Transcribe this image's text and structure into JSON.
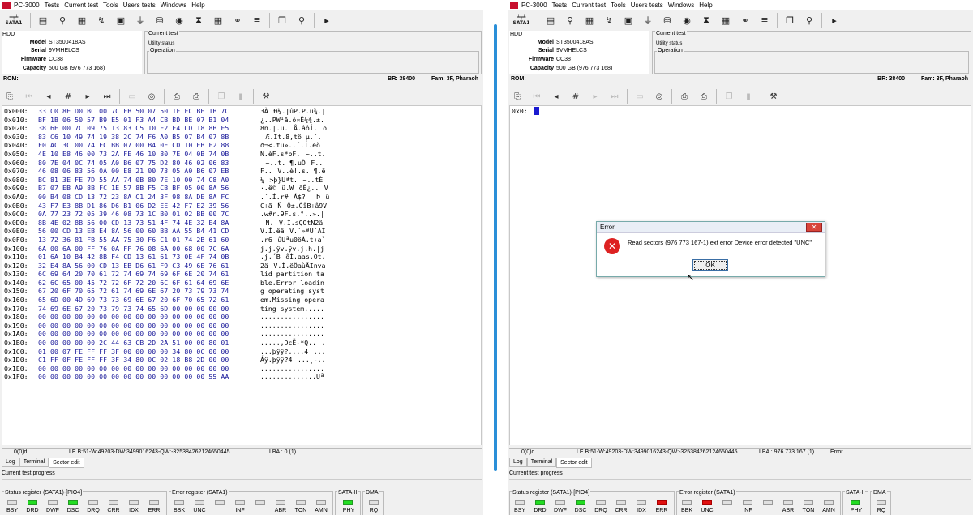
{
  "app": {
    "title": "PC-3000"
  },
  "menu": [
    "Tests",
    "Current test",
    "Tools",
    "Users tests",
    "Windows",
    "Help"
  ],
  "toolbar": {
    "sata_label": "SATA1"
  },
  "hdd": {
    "label": "HDD",
    "fields": [
      {
        "k": "Model",
        "v": "ST3500418AS"
      },
      {
        "k": "Serial",
        "v": "9VMHELCS"
      },
      {
        "k": "Firmware",
        "v": "CC38"
      },
      {
        "k": "Capacity",
        "v": "500 GB (976 773 168)"
      }
    ]
  },
  "current_test": {
    "label": "Current test",
    "status": "Utility status",
    "operation_label": "Operation"
  },
  "rom": {
    "label": "ROM:",
    "br": "BR: 38400",
    "fam": "Fam: 3F, Pharaoh"
  },
  "left": {
    "hex_rows": [
      {
        "off": "0x000:",
        "hex": "33 C0 8E D0 BC 00 7C FB 50 07 50 1F FC BE 1B 7C",
        "asc": "3ÀÐ¼.|ûP.P.ü¾.|"
      },
      {
        "off": "0x010:",
        "hex": "BF 1B 06 50 57 B9 E5 01 F3 A4 CB BD BE 07 B1 04",
        "asc": "¿..PW¹å.ó¤Ë½¾.±."
      },
      {
        "off": "0x020:",
        "hex": "38 6E 00 7C 09 75 13 83 C5 10 E2 F4 CD 18 8B F5",
        "asc": "8n.|.u.Å.âôÍ.õ"
      },
      {
        "off": "0x030:",
        "hex": "83 C6 10 49 74 19 38 2C 74 F6 A0 B5 07 B4 07 8B",
        "asc": "Æ.It.8,tö µ.´."
      },
      {
        "off": "0x040:",
        "hex": "F0 AC 3C 00 74 FC BB 07 00 B4 0E CD 10 EB F2 88",
        "asc": "ð¬<.tü»..´.Í.ëò"
      },
      {
        "off": "0x050:",
        "hex": "4E 10 E8 46 00 73 2A FE 46 10 80 7E 04 0B 74 0B",
        "asc": "N.èF.s*þF.~..t."
      },
      {
        "off": "0x060:",
        "hex": "80 7E 04 0C 74 05 A0 B6 07 75 D2 80 46 02 06 83",
        "asc": "~..t. ¶.uÒF.."
      },
      {
        "off": "0x070:",
        "hex": "46 08 06 83 56 0A 00 E8 21 00 73 05 A0 B6 07 EB",
        "asc": "F..V..è!.s. ¶.ë"
      },
      {
        "off": "0x080:",
        "hex": "BC 81 3E FE 7D 55 AA 74 0B 80 7E 10 00 74 C8 A0",
        "asc": "¼>þ}Uªt.~..tÈ "
      },
      {
        "off": "0x090:",
        "hex": "B7 07 EB A9 8B FC 1E 57 8B F5 CB BF 05 00 8A 56",
        "asc": "·.ë©ü.WõË¿..V"
      },
      {
        "off": "0x0A0:",
        "hex": "00 B4 08 CD 13 72 23 8A C1 24 3F 98 8A DE 8A FC",
        "asc": ".´.Í.r#Á$?Þü"
      },
      {
        "off": "0x0B0:",
        "hex": "43 F7 E3 8B D1 86 D6 B1 06 D2 EE 42 F7 E2 39 56",
        "asc": "C÷ãÑÖ±.ÒîB÷â9V"
      },
      {
        "off": "0x0C0:",
        "hex": "0A 77 23 72 05 39 46 08 73 1C B0 01 02 BB 00 7C",
        "asc": ".w#r.9F.s.°..».|"
      },
      {
        "off": "0x0D0:",
        "hex": "8B 4E 02 8B 56 00 CD 13 73 51 4F 74 4E 32 E4 8A",
        "asc": "N.V.Í.sQOtN2ä"
      },
      {
        "off": "0x0E0:",
        "hex": "56 00 CD 13 EB E4 8A 56 00 60 BB AA 55 B4 41 CD",
        "asc": "V.Í.ëäV.`»ªU´AÍ"
      },
      {
        "off": "0x0F0:",
        "hex": "13 72 36 81 FB 55 AA 75 30 F6 C1 01 74 2B 61 60",
        "asc": ".r6ûUªu0öÁ.t+a`"
      },
      {
        "off": "0x100:",
        "hex": "6A 00 6A 00 FF 76 0A FF 76 08 6A 00 68 00 7C 6A",
        "asc": "j.j.ÿv.ÿv.j.h.|j"
      },
      {
        "off": "0x110:",
        "hex": "01 6A 10 B4 42 8B F4 CD 13 61 61 73 0E 4F 74 0B",
        "asc": ".j.´BôÍ.aas.Ot."
      },
      {
        "off": "0x120:",
        "hex": "32 E4 8A 56 00 CD 13 EB D6 61 F9 C3 49 6E 76 61",
        "asc": "2äV.Í.ëÖaùÃInva"
      },
      {
        "off": "0x130:",
        "hex": "6C 69 64 20 70 61 72 74 69 74 69 6F 6E 20 74 61",
        "asc": "lid partition ta"
      },
      {
        "off": "0x140:",
        "hex": "62 6C 65 00 45 72 72 6F 72 20 6C 6F 61 64 69 6E",
        "asc": "ble.Error loadin"
      },
      {
        "off": "0x150:",
        "hex": "67 20 6F 70 65 72 61 74 69 6E 67 20 73 79 73 74",
        "asc": "g operating syst"
      },
      {
        "off": "0x160:",
        "hex": "65 6D 00 4D 69 73 73 69 6E 67 20 6F 70 65 72 61",
        "asc": "em.Missing opera"
      },
      {
        "off": "0x170:",
        "hex": "74 69 6E 67 20 73 79 73 74 65 6D 00 00 00 00 00",
        "asc": "ting system....."
      },
      {
        "off": "0x180:",
        "hex": "00 00 00 00 00 00 00 00 00 00 00 00 00 00 00 00",
        "asc": "................"
      },
      {
        "off": "0x190:",
        "hex": "00 00 00 00 00 00 00 00 00 00 00 00 00 00 00 00",
        "asc": "................"
      },
      {
        "off": "0x1A0:",
        "hex": "00 00 00 00 00 00 00 00 00 00 00 00 00 00 00 00",
        "asc": "................"
      },
      {
        "off": "0x1B0:",
        "hex": "00 00 00 00 00 2C 44 63 CB 2D 2A 51 00 00 80 01",
        "asc": ".....,DcË-*Q..."
      },
      {
        "off": "0x1C0:",
        "hex": "01 00 07 FE FF FF 3F 00 00 00 00 34 80 0C 00 00",
        "asc": "...þÿÿ?....4..."
      },
      {
        "off": "0x1D0:",
        "hex": "C1 FF 0F FE FF FF 3F 34 80 0C 02 18 B8 2D 00 00",
        "asc": "Áÿ.þÿÿ?4...¸-.."
      },
      {
        "off": "0x1E0:",
        "hex": "00 00 00 00 00 00 00 00 00 00 00 00 00 00 00 00",
        "asc": "................"
      },
      {
        "off": "0x1F0:",
        "hex": "00 00 00 00 00 00 00 00 00 00 00 00 00 00 55 AA",
        "asc": "..............Uª"
      }
    ],
    "status": {
      "pos": "0(0)d",
      "le": "LE B:51-W:49203-DW:3499016243-QW:-325384262124650445",
      "lba": "LBA : 0 (1)"
    }
  },
  "right": {
    "editor_line": "0x0:",
    "status": {
      "pos": "0(0)d",
      "le": "LE B:51-W:49203-DW:3499016243-QW:-325384262124650445",
      "lba": "LBA : 976 773 167 (1)",
      "msg": "Error"
    }
  },
  "tabs": [
    "Log",
    "Terminal",
    "Sector edit"
  ],
  "progress_label": "Current test progress",
  "registers": {
    "status_title": "Status register (SATA1)-[PIO4]",
    "error_title": "Error register (SATA1)",
    "sata_title": "SATA-II",
    "dma_title": "DMA",
    "status_bits": [
      "BSY",
      "DRD",
      "DWF",
      "DSC",
      "DRQ",
      "CRR",
      "IDX",
      "ERR"
    ],
    "error_bits": [
      "BBK",
      "UNC",
      "",
      "INF",
      "",
      "ABR",
      "TON",
      "AMN"
    ],
    "phy": "PHY",
    "rq": "RQ"
  },
  "dialog": {
    "title": "Error",
    "message": "Read sectors (976 773 167-1) ext error Device error detected \"UNC\"",
    "ok": "OK",
    "close": "✕"
  }
}
